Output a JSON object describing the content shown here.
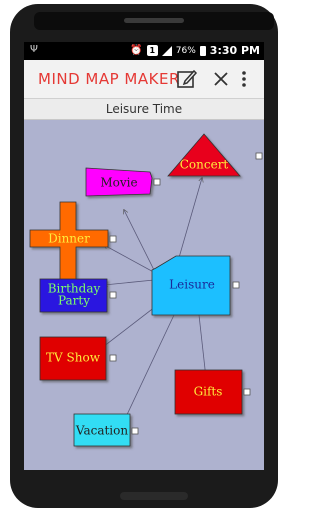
{
  "status": {
    "battery": "76%",
    "time": "3:30 PM",
    "sim_badge": "1"
  },
  "app": {
    "title": "MIND MAP MAKER"
  },
  "map": {
    "title": "Leisure Time"
  },
  "nodes": {
    "center": "Leisure",
    "movie": "Movie",
    "concert": "Concert",
    "dinner": "Dinner",
    "birthday_line1": "Birthday",
    "birthday_line2": "Party",
    "tvshow": "TV Show",
    "gifts": "Gifts",
    "vacation": "Vacation"
  },
  "colors": {
    "background": "#aeb2cf",
    "title_red": "#e53935",
    "movie": "#ff00ff",
    "concert": "#e8001c",
    "dinner": "#ff6a00",
    "birthday": "#2a12e0",
    "center": "#1fbfff",
    "tvshow": "#e00000",
    "gifts": "#e00000",
    "vacation": "#33ddf4"
  },
  "icons": [
    "usb-icon",
    "alarm-icon",
    "signal-icon",
    "battery-icon",
    "edit-icon",
    "close-icon",
    "overflow-menu-icon"
  ]
}
